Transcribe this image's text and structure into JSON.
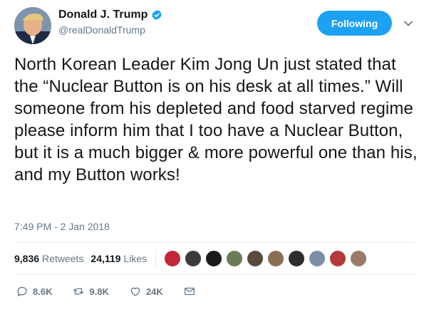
{
  "header": {
    "display_name": "Donald J. Trump",
    "handle": "@realDonaldTrump",
    "follow_label": "Following"
  },
  "tweet": {
    "text": "North Korean Leader Kim Jong Un just stated that the “Nuclear Button is on his desk at all times.” Will someone from his depleted and food starved regime please inform him that I too have a Nuclear Button, but it is a much bigger & more powerful one than his, and my Button works!",
    "timestamp": "7:49 PM - 2 Jan 2018"
  },
  "stats": {
    "retweets_count": "9,836",
    "retweets_label": "Retweets",
    "likes_count": "24,119",
    "likes_label": "Likes"
  },
  "likers": [
    {
      "name": "liker-1",
      "color": "#c2263a"
    },
    {
      "name": "liker-2",
      "color": "#3b3b3b"
    },
    {
      "name": "liker-3",
      "color": "#1a1a1a"
    },
    {
      "name": "liker-4",
      "color": "#6b7b5a"
    },
    {
      "name": "liker-5",
      "color": "#5a4a3a"
    },
    {
      "name": "liker-6",
      "color": "#8a6f55"
    },
    {
      "name": "liker-7",
      "color": "#2d2d2d"
    },
    {
      "name": "liker-8",
      "color": "#7a8fa6"
    },
    {
      "name": "liker-9",
      "color": "#b23a3a"
    },
    {
      "name": "liker-10",
      "color": "#9a7a6a"
    }
  ],
  "actions": {
    "replies": "8.6K",
    "retweets": "9.8K",
    "likes": "24K"
  },
  "colors": {
    "accent": "#1da1f2",
    "text": "#14171a",
    "muted": "#657786"
  }
}
